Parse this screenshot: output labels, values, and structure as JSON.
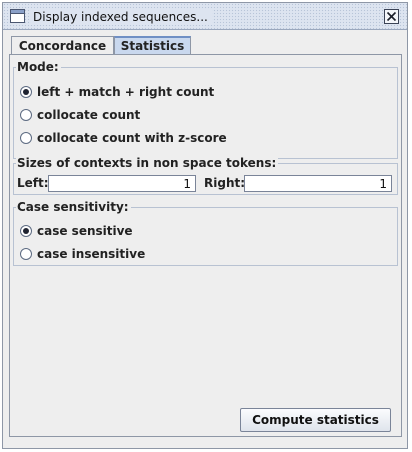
{
  "window": {
    "title": "Display indexed sequences...",
    "close_icon": "close-icon"
  },
  "tabs": [
    {
      "label": "Concordance",
      "selected": false
    },
    {
      "label": "Statistics",
      "selected": true
    }
  ],
  "mode": {
    "title": "Mode:",
    "options": [
      {
        "label": "left + match + right count",
        "checked": true
      },
      {
        "label": "collocate count",
        "checked": false
      },
      {
        "label": "collocate count with z-score",
        "checked": false
      }
    ]
  },
  "sizes": {
    "title": "Sizes of contexts in non space tokens:",
    "left_label": "Left:",
    "left_value": "1",
    "right_label": "Right:",
    "right_value": "1"
  },
  "case": {
    "title": "Case sensitivity:",
    "options": [
      {
        "label": "case sensitive",
        "checked": true
      },
      {
        "label": "case insensitive",
        "checked": false
      }
    ]
  },
  "compute_button": {
    "label": "Compute statistics"
  },
  "colors": {
    "selected_tab": "#c9d8ee",
    "window_bg": "#eeeeee",
    "titlebar_bg": "#dde4f0"
  }
}
